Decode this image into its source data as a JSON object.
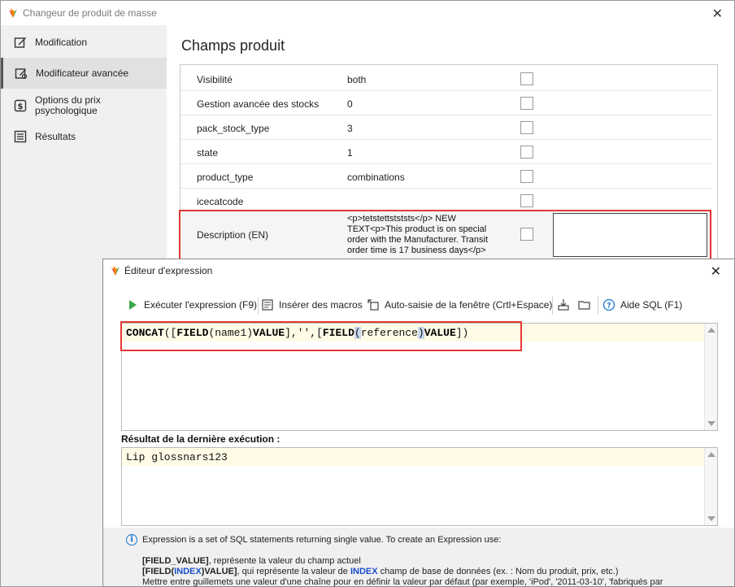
{
  "main_window": {
    "title": "Changeur de produit de masse"
  },
  "sidebar": {
    "items": [
      {
        "label": "Modification",
        "icon": "edit-icon"
      },
      {
        "label": "Modificateur avancée",
        "icon": "advanced-edit-icon"
      },
      {
        "label": "Options du prix psychologique",
        "icon": "price-icon"
      },
      {
        "label": "Résultats",
        "icon": "results-icon"
      }
    ]
  },
  "content": {
    "section_title": "Champs produit",
    "fields": [
      {
        "name": "Visibilité",
        "value": "both"
      },
      {
        "name": "Gestion avancée des stocks",
        "value": "0"
      },
      {
        "name": "pack_stock_type",
        "value": "3"
      },
      {
        "name": "state",
        "value": "1"
      },
      {
        "name": "product_type",
        "value": "combinations"
      },
      {
        "name": "icecatcode",
        "value": ""
      }
    ],
    "description": {
      "name": "Description (EN)",
      "value": "<p>tetstettstststs</p> NEW TEXT<p>This product is on special order with the Manufacturer. Transit order time is 17 business days</p>"
    }
  },
  "expression_dialog": {
    "title": "Éditeur d'expression",
    "toolbar": {
      "run": "Exécuter l'expression (F9)",
      "insert_macros": "Insérer des macros",
      "autofill": "Auto-saisie de la fenêtre (Crtl+Espace)",
      "help": "Aide SQL (F1)"
    },
    "expression": {
      "p1": "CONCAT",
      "p2": "([",
      "p3": "FIELD",
      "p4": "(name1)",
      "p5": "VALUE",
      "p6": "],'',[",
      "p7": "FIELD",
      "p8": "(",
      "p9": "reference",
      "p10": ")",
      "p11": "VALUE",
      "p12": "])"
    },
    "result_label": "Résultat de la dernière exécution :",
    "result_value": "Lip glossnars123",
    "info": {
      "intro": "Expression is a set of SQL statements returning single value. To create an Expression use:",
      "line1_bold": "[FIELD_VALUE]",
      "line1_rest": ", représente la valeur du champ actuel",
      "line2_a": "[FIELD(",
      "line2_b": "INDEX",
      "line2_c": ")VALUE]",
      "line2_d": ", qui représente la valeur de ",
      "line2_e": "INDEX",
      "line2_f": " champ de base de données (ex. : Nom du produit, prix, etc.)",
      "line3": "Mettre entre guillemets une valeur d'une chaîne pour en définir la valeur par défaut (par exemple, 'iPod', '2011-03-10', 'fabriqués par"
    }
  }
}
